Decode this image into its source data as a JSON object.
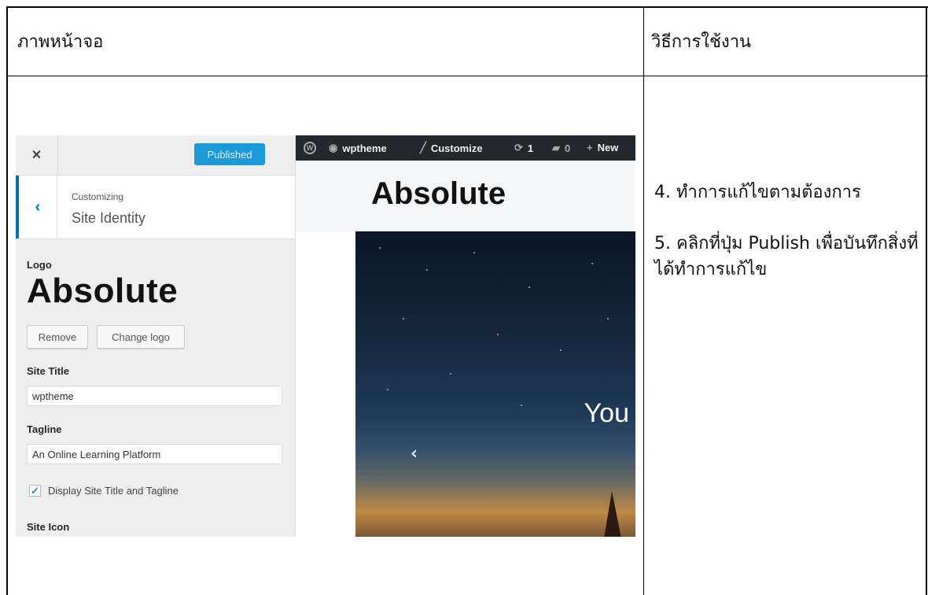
{
  "table": {
    "header_left": "ภาพหน้าจอ",
    "header_right": "วิธีการใช้งาน",
    "step4": "4. ทำการแก้ไขตามต้องการ",
    "step5": "5. คลิกที่ปุ่ม Publish เพื่อบันทึกสิ่งที่ได้ทำการแก้ไข"
  },
  "customizer": {
    "close_glyph": "×",
    "publish_label": "Published",
    "back_glyph": "‹",
    "section_small": "Customizing",
    "section_title": "Site Identity",
    "logo_label": "Logo",
    "logo_text": "Absolute",
    "remove_label": "Remove",
    "change_logo_label": "Change logo",
    "site_title_label": "Site Title",
    "site_title_value": "wptheme",
    "tagline_label": "Tagline",
    "tagline_value": "An Online Learning Platform",
    "display_label": "Display Site Title and Tagline",
    "display_checked": true,
    "site_icon_label": "Site Icon",
    "accent_color": "#1a9bd7"
  },
  "preview": {
    "adminbar": {
      "wp_logo_icon": "wordpress-icon",
      "site_name": "wptheme",
      "customize": "Customize",
      "updates_count": "1",
      "comments_count": "0",
      "new_label": "New"
    },
    "site_title": "Absolute",
    "hero_text": "You",
    "hero_arrow": "‹"
  }
}
